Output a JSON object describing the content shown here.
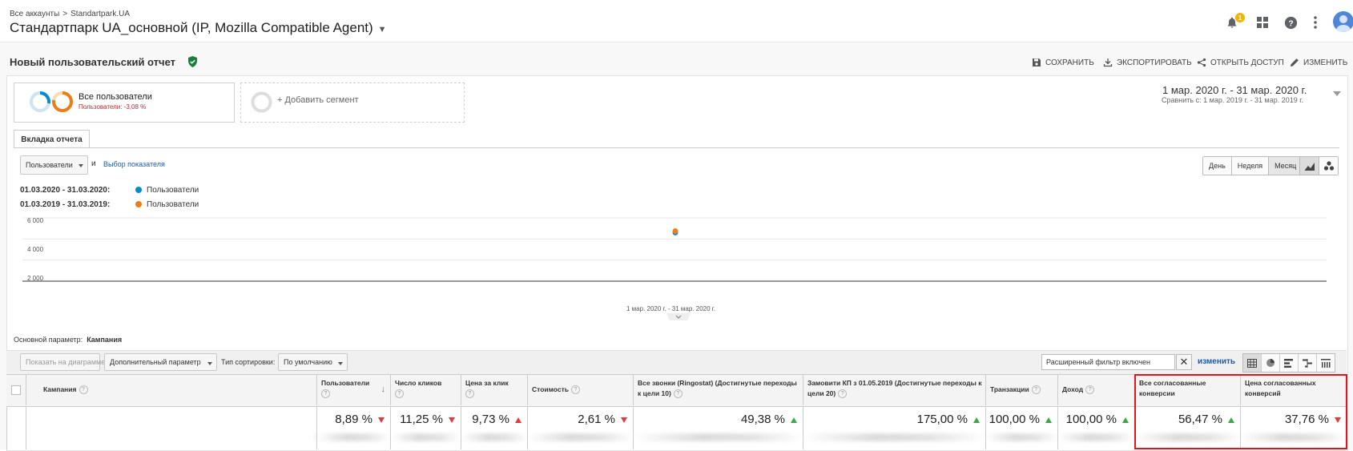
{
  "header": {
    "breadcrumb_root": "Все аккаунты",
    "breadcrumb_property": "Standartpark.UA",
    "account_title": "Стандартпарк UA_основной (IP, Mozilla Compatible Agent)",
    "notification_count": "1"
  },
  "report": {
    "title": "Новый пользовательский отчет",
    "save_label": "СОХРАНИТЬ",
    "export_label": "ЭКСПОРТИРОВАТЬ",
    "share_label": "ОТКРЫТЬ ДОСТУП",
    "edit_label": "ИЗМЕНИТЬ"
  },
  "segments": {
    "primary_name": "Все пользователи",
    "primary_sub": "Пользователи: -3,08 %",
    "add_label": "+ Добавить сегмент"
  },
  "dates": {
    "range": "1 мар. 2020 г. - 31 мар. 2020 г.",
    "compare_prefix": "Сравнить с:",
    "compare_range": "1 мар. 2019 г. - 31 мар. 2019 г."
  },
  "tab": {
    "label": "Вкладка отчета"
  },
  "controls": {
    "metric_select": "Пользователи",
    "and_text": "и",
    "metric_link": "Выбор показателя",
    "periods": [
      "День",
      "Неделя",
      "Месяц"
    ]
  },
  "legend": [
    {
      "date": "01.03.2020 - 31.03.2020:",
      "label": "Пользователи",
      "color": "#058dc7"
    },
    {
      "date": "01.03.2019 - 31.03.2019:",
      "label": "Пользователи",
      "color": "#ed7e17"
    }
  ],
  "chart_data": {
    "type": "scatter",
    "categories": [
      "1 мар. 2020 г. - 31 мар. 2020 г."
    ],
    "yticks": [
      "2 000",
      "4 000",
      "6 000"
    ],
    "ylim": [
      0,
      6000
    ],
    "series": [
      {
        "name": "Пользователи",
        "color": "#058dc7",
        "values": [
          4600
        ]
      },
      {
        "name": "Пользователи",
        "color": "#ed7e17",
        "values": [
          4750
        ]
      }
    ],
    "grid": true
  },
  "table_controls": {
    "primary_label": "Основной параметр:",
    "primary_value": "Кампания",
    "show_on_chart": "Показать на диаграмме",
    "extra_param": "Дополнительный параметр",
    "sort_label": "Тип сортировки:",
    "sort_value": "По умолчанию",
    "filter_text": "Расширенный фильтр включен",
    "filter_edit": "изменить"
  },
  "table": {
    "columns": [
      "Кампания",
      "Пользователи",
      "Число кликов",
      "Цена за клик",
      "Стоимость",
      "Все звонки (Ringostat) (Достигнутые переходы к цели 10)",
      "Замовити КП з 01.05.2019 (Достигнутые переходы к цели 20)",
      "Транзакции",
      "Доход",
      "Все согласованные конверсии",
      "Цена согласованных конверсий"
    ],
    "totals": [
      "8,89 %",
      "11,25 %",
      "9,73 %",
      "2,61 %",
      "49,38 %",
      "175,00 %",
      "100,00 %",
      "100,00 %",
      "56,47 %",
      "37,76 %"
    ]
  }
}
